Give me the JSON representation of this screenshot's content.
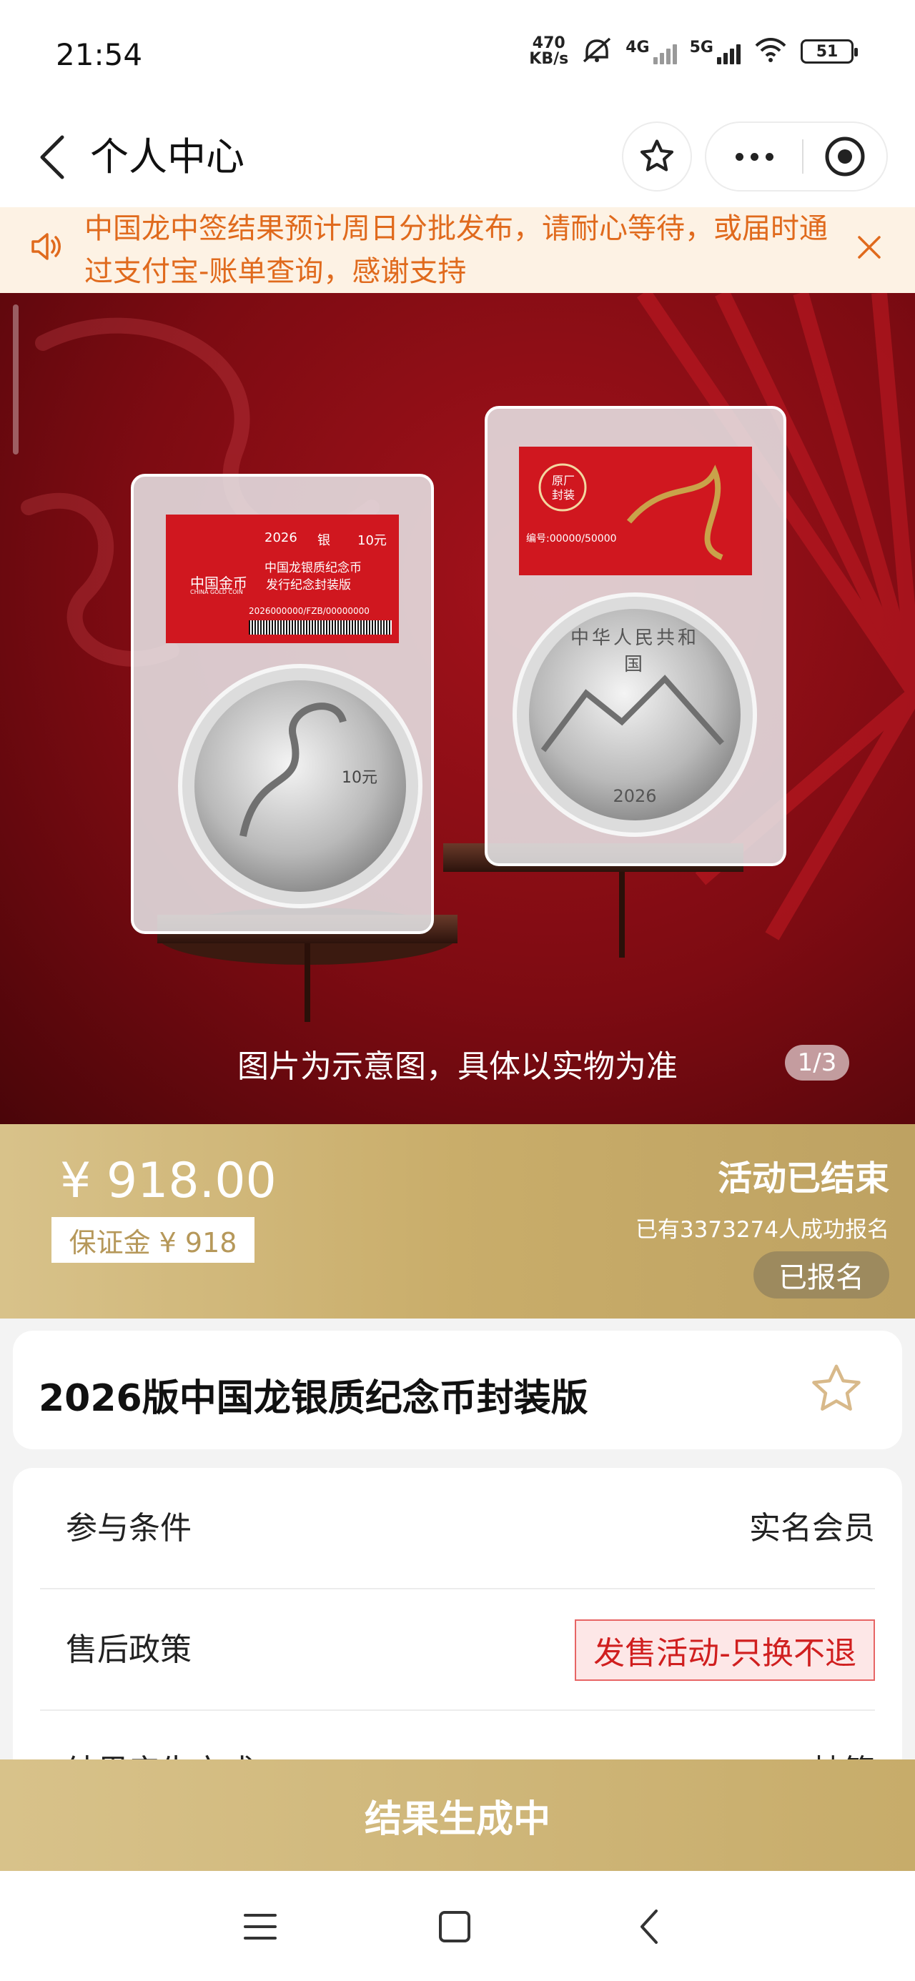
{
  "status_bar": {
    "time": "21:54",
    "net_speed_value": "470",
    "net_speed_unit": "KB/s",
    "signal1_label": "4G",
    "signal2_label": "5G",
    "battery": "51"
  },
  "nav": {
    "title": "个人中心"
  },
  "notice": {
    "text": "中国龙中签结果预计周日分批发布，请耐心等待，或届时通过支付宝-账单查询，感谢支持"
  },
  "hero": {
    "caption": "图片为示意图，具体以实物为准",
    "indicator": "1/3",
    "left_label_year": "2026",
    "left_label_metal": "银",
    "left_label_value": "10元",
    "left_label_brand": "中国金币",
    "left_label_brand_en": "CHINA GOLD COIN",
    "left_label_line1": "中国龙银质纪念币",
    "left_label_line2": "发行纪念封装版",
    "left_label_serial": "2026000000/FZB/00000000",
    "right_label_badge": "原厂封装",
    "right_label_serial": "编号:00000/50000",
    "coin_left_denom": "10元",
    "coin_right_legend": "中华人民共和国",
    "coin_right_year": "2026"
  },
  "price_band": {
    "price": "¥ 918.00",
    "deposit": "保证金 ¥ 918",
    "status": "活动已结束",
    "signup_count": "已有3373274人成功报名",
    "signed_label": "已报名"
  },
  "product": {
    "name": "2026版中国龙银质纪念币封装版"
  },
  "info": {
    "rows": [
      {
        "label": "参与条件",
        "value": "实名会员"
      },
      {
        "label": "售后政策",
        "value": "发售活动-只换不退"
      },
      {
        "label": "结果产生方式",
        "value": "抽签"
      }
    ]
  },
  "action": {
    "label": "结果生成中"
  },
  "colors": {
    "notice_text": "#e06a1d",
    "gold": "#c9ad6a",
    "policy_red": "#d01f1f"
  }
}
